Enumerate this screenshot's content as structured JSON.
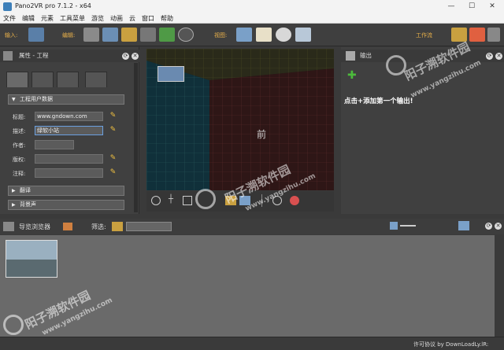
{
  "window": {
    "title": "Pano2VR pro 7.1.2 - x64",
    "min": "—",
    "max": "☐",
    "close": "✕"
  },
  "menu": [
    "文件",
    "编辑",
    "元素",
    "工具菜单",
    "游览",
    "动画",
    "云",
    "窗口",
    "帮助"
  ],
  "toolbar": {
    "input_label": "输入:",
    "edit_label": "编辑:",
    "view_label": "视图:",
    "workflow_label": "工作流"
  },
  "left_panel": {
    "title": "属性 - 工程",
    "section_project": "工程用户数据",
    "fields": [
      {
        "label": "标题:",
        "value": "www.gndown.com"
      },
      {
        "label": "描述:",
        "value": "绿软小站"
      },
      {
        "label": "作者:",
        "value": ""
      },
      {
        "label": "版权:",
        "value": ""
      },
      {
        "label": "注释:",
        "value": ""
      }
    ],
    "section_translate": "翻译",
    "section_bgsound": "背景声"
  },
  "viewer": {
    "center_text": "前"
  },
  "right_panel": {
    "title": "输出",
    "add_output_text": "点击+添加第一个输出!"
  },
  "tour_browser": {
    "title": "导览浏览器",
    "filter_label": "筛选:"
  },
  "status_bar": {
    "license_text": "许可协议 by DownLoadLy.lR:"
  },
  "watermark": {
    "text": "阳子溯软件园",
    "url": "www.yangzihu.com"
  }
}
